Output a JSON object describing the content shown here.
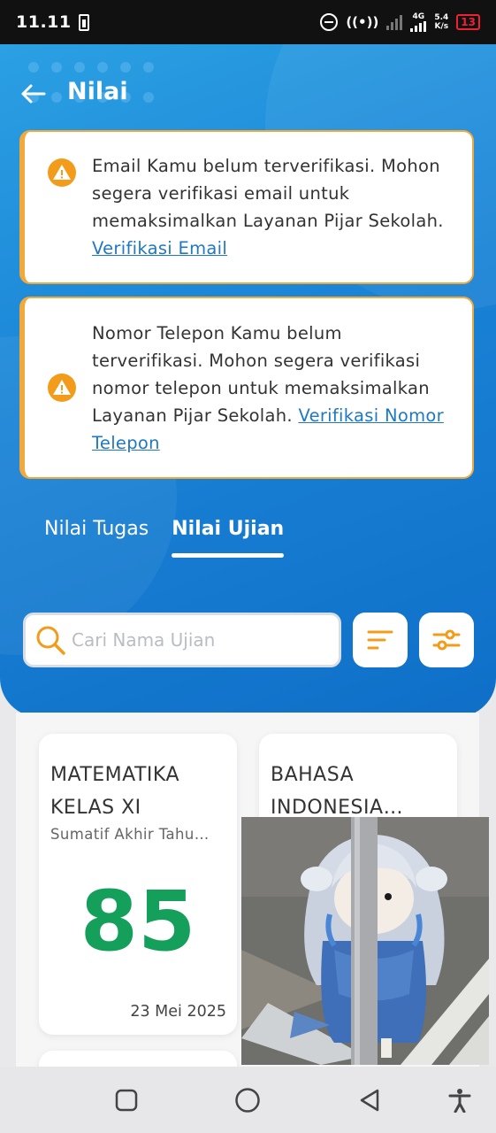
{
  "status_bar": {
    "time": "11.11",
    "network": "4G",
    "speed_value": "5.4",
    "speed_unit": "K/s",
    "battery": "13"
  },
  "header": {
    "title": "Nilai",
    "back_icon": "arrow-left-icon"
  },
  "alerts": [
    {
      "icon": "warning-icon",
      "text": "Email Kamu belum terverifikasi. Mohon segera verifikasi email untuk memaksimalkan Layanan Pijar Sekolah. ",
      "link": "Verifikasi Email"
    },
    {
      "icon": "warning-icon",
      "text": "Nomor Telepon Kamu belum terverifikasi. Mohon segera verifikasi nomor telepon untuk memaksimalkan Layanan Pijar Sekolah. ",
      "link": "Verifikasi Nomor Telepon"
    }
  ],
  "tabs": [
    {
      "label": "Nilai Tugas",
      "active": false
    },
    {
      "label": "Nilai Ujian",
      "active": true
    }
  ],
  "search": {
    "placeholder": "Cari Nama Ujian"
  },
  "exams": [
    {
      "name": "MATEMATIKA KELAS XI",
      "type": "Sumatif Akhir Tahu…",
      "score": "85",
      "date": "23 Mei 2025"
    },
    {
      "name": "BAHASA INDONESIA…"
    }
  ],
  "colors": {
    "header_blue": "#1a83d6",
    "accent_orange": "#f39b1a",
    "score_green": "#14a05a",
    "link_blue": "#1f78c4"
  }
}
